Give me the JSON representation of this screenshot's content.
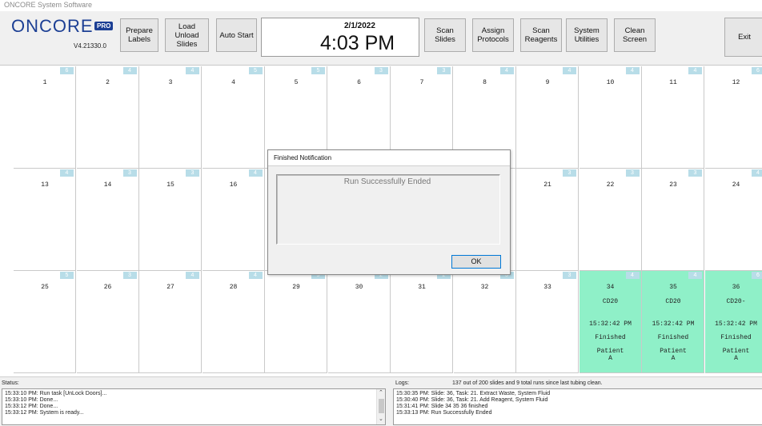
{
  "window": {
    "title": "ONCORE System Software"
  },
  "logo": {
    "text": "ONCORE",
    "badge": "PRO",
    "version": "V4.21330.0"
  },
  "toolbar": {
    "buttons": [
      {
        "label": "Prepare\nLabels"
      },
      {
        "label": "Load\nUnload\nSlides"
      },
      {
        "label": "Auto Start"
      },
      {
        "label": "Scan\nSlides"
      },
      {
        "label": "Assign\nProtocols"
      },
      {
        "label": "Scan\nReagents"
      },
      {
        "label": "System\nUtilities"
      },
      {
        "label": "Clean\nScreen"
      },
      {
        "label": "Exit"
      }
    ],
    "gear_icon": "gears-icon"
  },
  "clock": {
    "date": "2/1/2022",
    "time": "4:03 PM"
  },
  "slides": [
    {
      "num": "1",
      "badge": "6"
    },
    {
      "num": "2",
      "badge": "4"
    },
    {
      "num": "3",
      "badge": "4"
    },
    {
      "num": "4",
      "badge": "5"
    },
    {
      "num": "5",
      "badge": "5"
    },
    {
      "num": "6",
      "badge": "3"
    },
    {
      "num": "7",
      "badge": "3"
    },
    {
      "num": "8",
      "badge": "4"
    },
    {
      "num": "9",
      "badge": "4"
    },
    {
      "num": "10",
      "badge": "4"
    },
    {
      "num": "11",
      "badge": "4"
    },
    {
      "num": "12",
      "badge": "6"
    },
    {
      "num": "13",
      "badge": "4"
    },
    {
      "num": "14",
      "badge": "3"
    },
    {
      "num": "15",
      "badge": "3"
    },
    {
      "num": "16",
      "badge": "4"
    },
    {
      "num": "",
      "badge": ""
    },
    {
      "num": "",
      "badge": ""
    },
    {
      "num": "",
      "badge": ""
    },
    {
      "num": "",
      "badge": ""
    },
    {
      "num": "21",
      "badge": "3"
    },
    {
      "num": "22",
      "badge": "3"
    },
    {
      "num": "23",
      "badge": "3"
    },
    {
      "num": "24",
      "badge": "4"
    },
    {
      "num": "25",
      "badge": "5"
    },
    {
      "num": "26",
      "badge": "3"
    },
    {
      "num": "27",
      "badge": "4"
    },
    {
      "num": "28",
      "badge": "4"
    },
    {
      "num": "29",
      "badge": "5"
    },
    {
      "num": "30",
      "badge": "2"
    },
    {
      "num": "31",
      "badge": "2"
    },
    {
      "num": "32",
      "badge": "3"
    },
    {
      "num": "33",
      "badge": "3"
    },
    {
      "num": "34",
      "badge": "4",
      "done": true,
      "marker": "CD20",
      "time": "15:32:42 PM",
      "status": "Finished",
      "patient": "Patient\nA"
    },
    {
      "num": "35",
      "badge": "4",
      "done": true,
      "marker": "CD20",
      "time": "15:32:42 PM",
      "status": "Finished",
      "patient": "Patient\nA"
    },
    {
      "num": "36",
      "badge": "6",
      "done": true,
      "marker": "CD20-",
      "time": "15:32:42 PM",
      "status": "Finished",
      "patient": "Patient\nA"
    }
  ],
  "dialog": {
    "title": "Finished Notification",
    "message": "Run Successfully Ended",
    "ok_label": "OK"
  },
  "status": {
    "label": "Status:",
    "lines": [
      "15:33:10 PM: Run task [UnLock Doors]...",
      "15:33:10 PM: Done...",
      "15:33:12 PM: Done...",
      "15:33:12 PM: System is ready..."
    ]
  },
  "logs": {
    "label": "Logs:",
    "summary": "137 out of 200 slides and  9 total runs since last tubing clean.",
    "lines": [
      "15:30:35 PM: Slide: 36, Task: 21. Extract Waste, System Fluid",
      "15:30:40 PM: Slide: 36, Task: 21. Add Reagent, System Fluid",
      "15:31:41 PM: Slide 34 35 36 finished",
      "15:33:13 PM: Run Successfully Ended"
    ]
  },
  "colors": {
    "brand": "#1c3f94",
    "finished": "#8ff0c8",
    "badge": "#b8dde8"
  }
}
